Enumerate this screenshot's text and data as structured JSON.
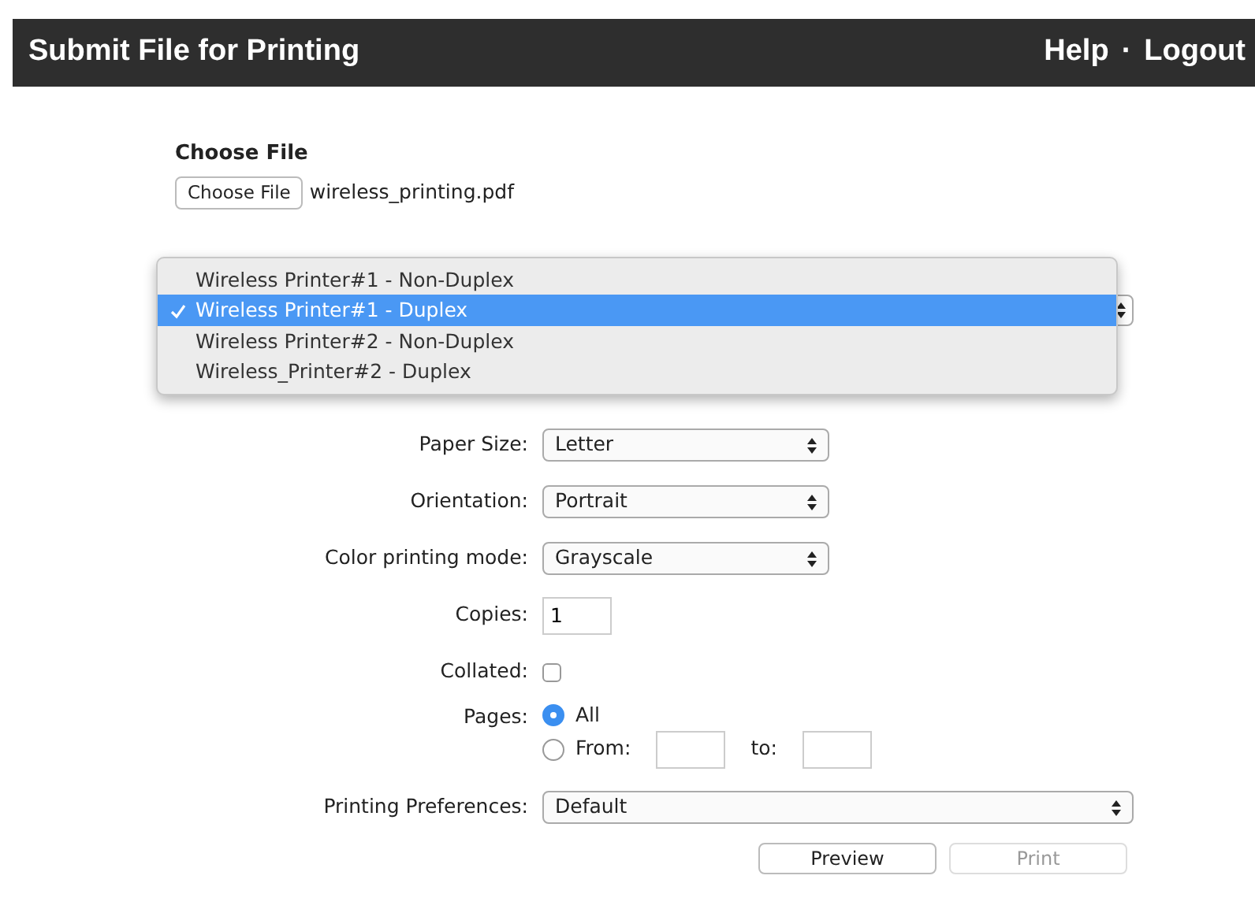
{
  "header": {
    "title": "Submit File for Printing",
    "links": [
      "Help",
      "Logout"
    ],
    "separator": "·"
  },
  "file": {
    "heading": "Choose File",
    "button": "Choose File",
    "filename": "wireless_printing.pdf"
  },
  "printer_menu": {
    "options": [
      {
        "label": "Wireless Printer#1 - Non-Duplex",
        "selected": false
      },
      {
        "label": "Wireless Printer#1 - Duplex",
        "selected": true
      },
      {
        "label": "Wireless Printer#2 - Non-Duplex",
        "selected": false
      },
      {
        "label": "Wireless_Printer#2 - Duplex",
        "selected": false
      }
    ]
  },
  "options": [
    {
      "kind": "select",
      "label": "Paper Size:",
      "value": "Letter",
      "wide": false
    },
    {
      "kind": "select",
      "label": "Orientation:",
      "value": "Portrait",
      "wide": false
    },
    {
      "kind": "select",
      "label": "Color printing mode:",
      "value": "Grayscale",
      "wide": false
    },
    {
      "kind": "text",
      "label": "Copies:",
      "value": "1"
    },
    {
      "kind": "checkbox",
      "label": "Collated:",
      "checked": false
    },
    {
      "kind": "pages",
      "label": "Pages:",
      "choices": [
        {
          "label": "All",
          "selected": true
        },
        {
          "label": "From:",
          "selected": false
        }
      ],
      "to_label": "to:"
    },
    {
      "kind": "select",
      "label": "Printing Preferences:",
      "value": "Default",
      "wide": true
    }
  ],
  "buttons": [
    {
      "label": "Preview",
      "disabled": false
    },
    {
      "label": "Print",
      "disabled": true
    }
  ]
}
